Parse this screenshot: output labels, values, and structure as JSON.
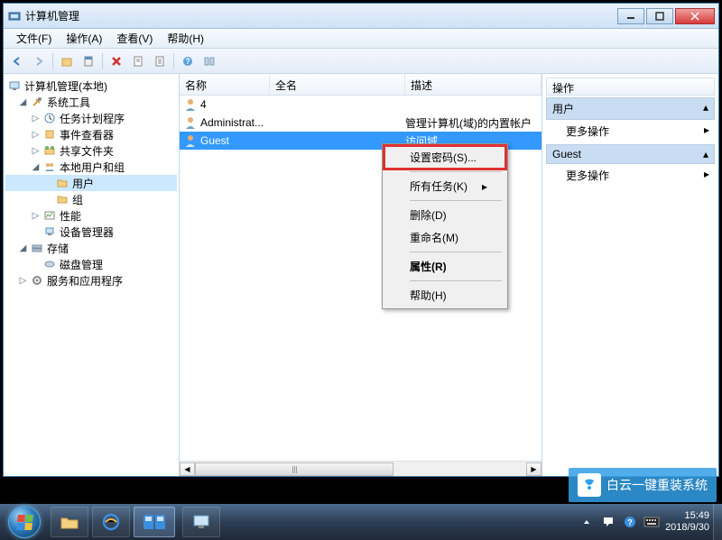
{
  "window": {
    "title": "计算机管理"
  },
  "menubar": {
    "file": "文件(F)",
    "action": "操作(A)",
    "view": "查看(V)",
    "help": "帮助(H)"
  },
  "tree": {
    "root": "计算机管理(本地)",
    "system_tools": "系统工具",
    "task_scheduler": "任务计划程序",
    "event_viewer": "事件查看器",
    "shared_folders": "共享文件夹",
    "local_users": "本地用户和组",
    "users": "用户",
    "groups": "组",
    "performance": "性能",
    "device_manager": "设备管理器",
    "storage": "存储",
    "disk_management": "磁盘管理",
    "services_apps": "服务和应用程序"
  },
  "list": {
    "columns": {
      "name": "名称",
      "fullname": "全名",
      "desc": "描述"
    },
    "rows": [
      {
        "name": "4",
        "full": "",
        "desc": ""
      },
      {
        "name": "Administrat...",
        "full": "",
        "desc": "管理计算机(域)的内置帐户"
      },
      {
        "name": "Guest",
        "full": "",
        "desc": "访问域"
      }
    ]
  },
  "actions": {
    "header": "操作",
    "section_users": "用户",
    "more": "更多操作",
    "section_guest": "Guest"
  },
  "context_menu": {
    "set_password": "设置密码(S)...",
    "all_tasks": "所有任务(K)",
    "delete": "删除(D)",
    "rename": "重命名(M)",
    "properties": "属性(R)",
    "help": "帮助(H)"
  },
  "taskbar": {
    "time": "15:49",
    "date": "2018/9/30"
  },
  "watermark": {
    "text": "白云一键重装系统"
  }
}
